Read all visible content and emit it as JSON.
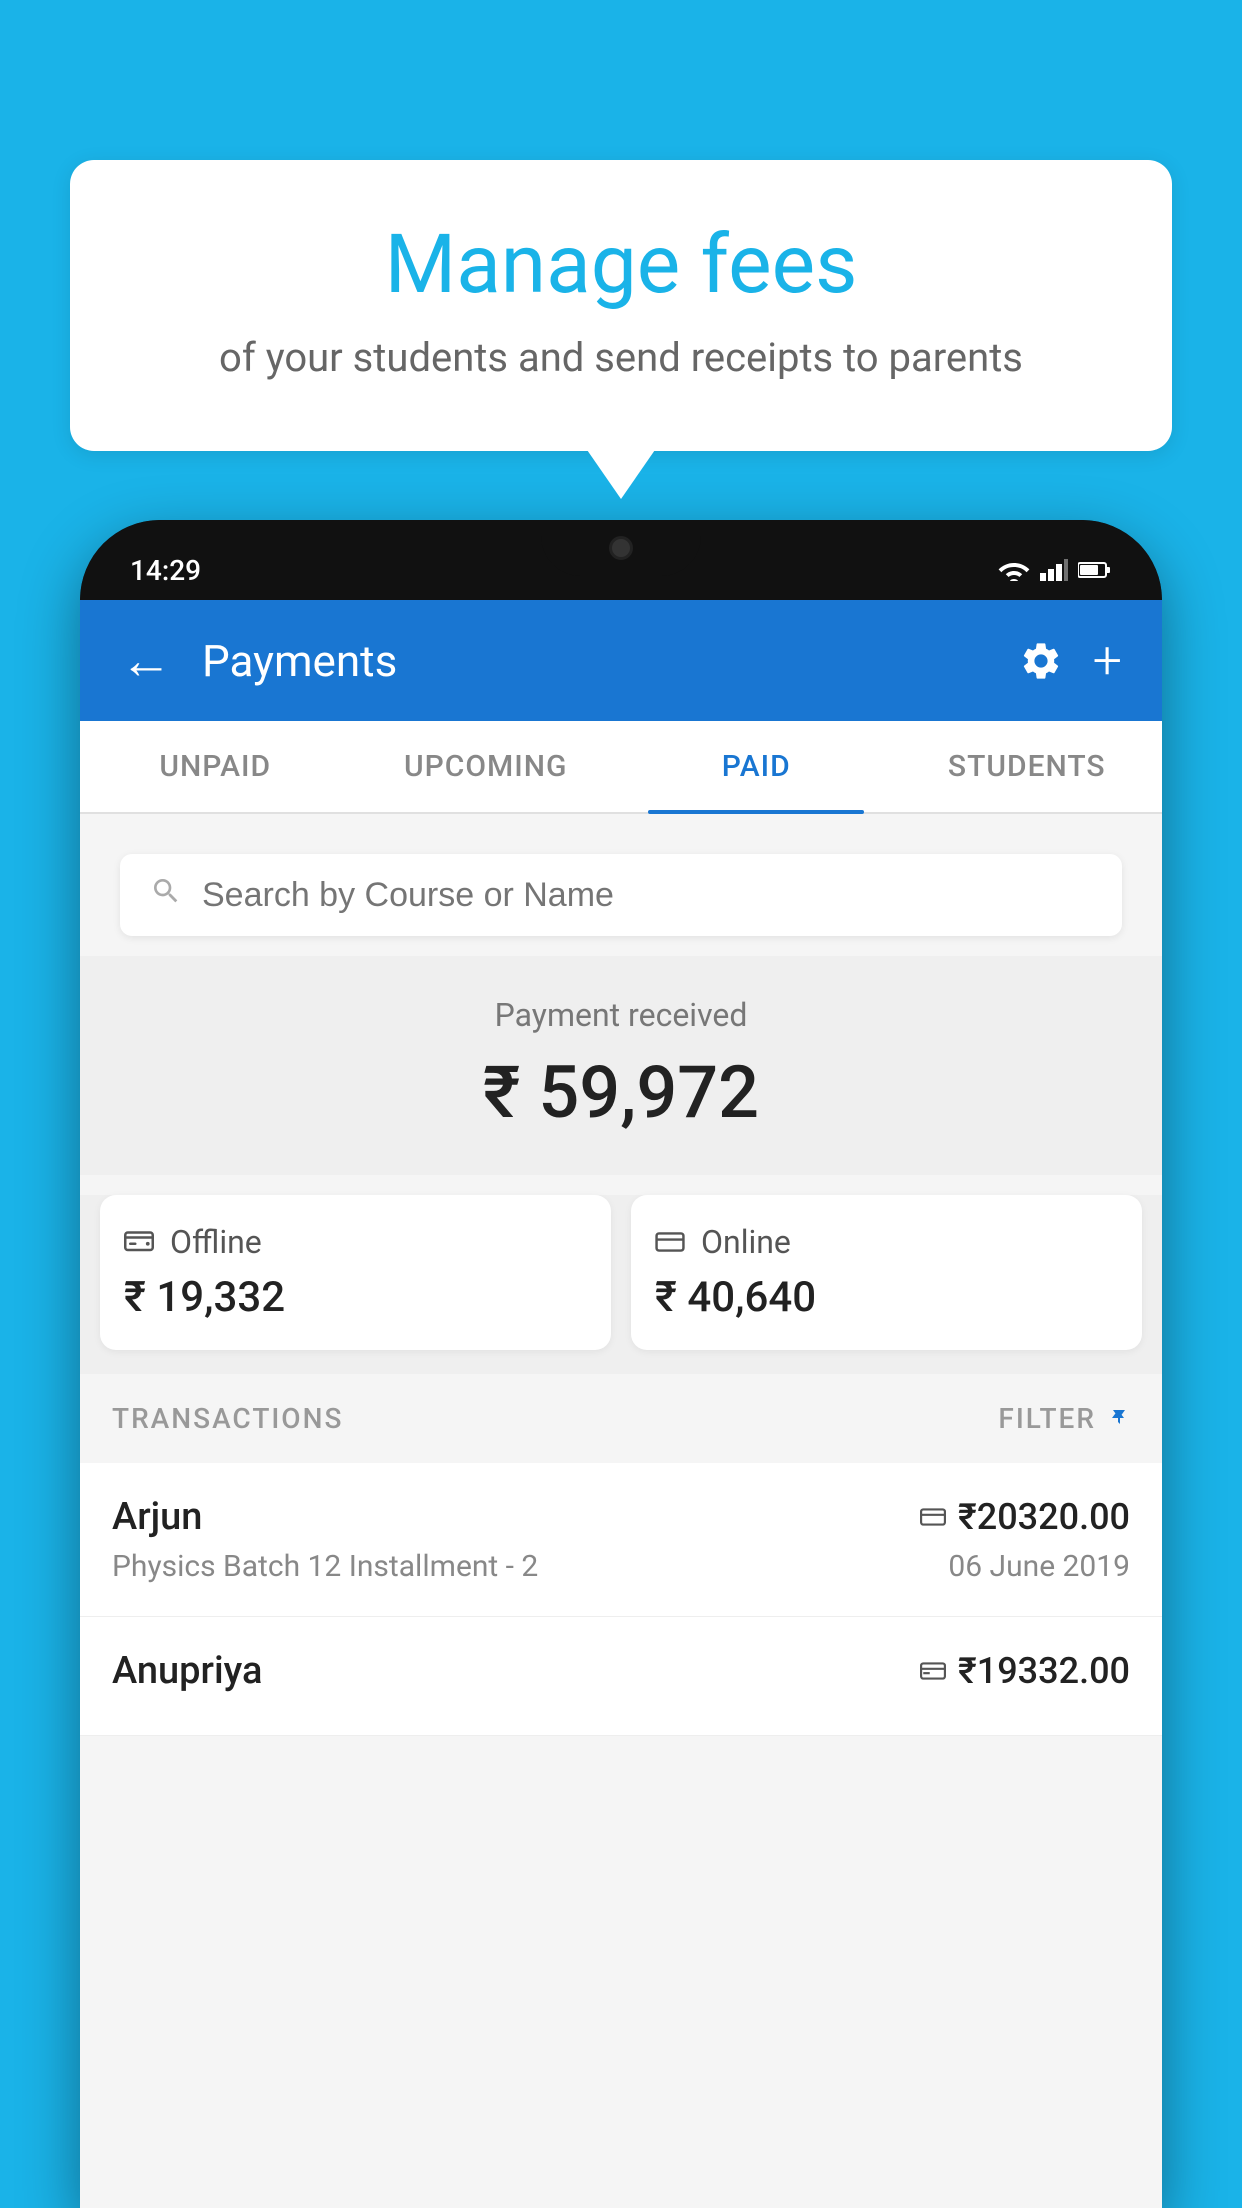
{
  "background_color": "#1ab3e8",
  "speech_bubble": {
    "title": "Manage fees",
    "subtitle": "of your students and send receipts to parents"
  },
  "phone": {
    "time": "14:29",
    "app_header": {
      "title": "Payments",
      "back_label": "←",
      "plus_label": "+"
    },
    "tabs": [
      {
        "label": "UNPAID",
        "active": false
      },
      {
        "label": "UPCOMING",
        "active": false
      },
      {
        "label": "PAID",
        "active": true
      },
      {
        "label": "STUDENTS",
        "active": false
      }
    ],
    "search": {
      "placeholder": "Search by Course or Name"
    },
    "payment_received": {
      "label": "Payment received",
      "amount": "₹ 59,972"
    },
    "payment_cards": [
      {
        "label": "Offline",
        "amount": "₹ 19,332",
        "icon": "offline"
      },
      {
        "label": "Online",
        "amount": "₹ 40,640",
        "icon": "online"
      }
    ],
    "transactions_section": {
      "title": "TRANSACTIONS",
      "filter_label": "FILTER"
    },
    "transactions": [
      {
        "name": "Arjun",
        "description": "Physics Batch 12 Installment - 2",
        "amount": "₹20320.00",
        "date": "06 June 2019",
        "payment_type": "online"
      },
      {
        "name": "Anupriya",
        "description": "",
        "amount": "₹19332.00",
        "date": "",
        "payment_type": "offline"
      }
    ]
  }
}
